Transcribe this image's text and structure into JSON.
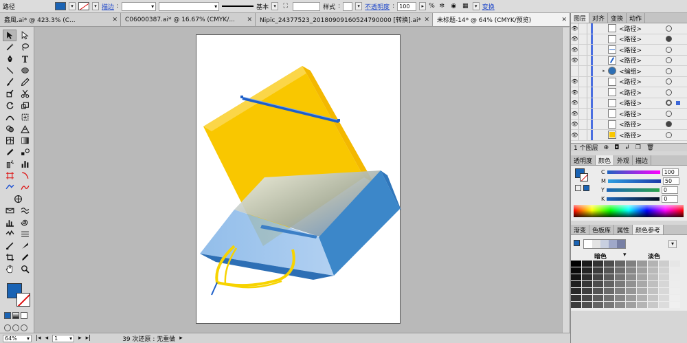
{
  "control_bar": {
    "object_type": "路径",
    "stroke_link": "描边",
    "stroke_weight": "",
    "profile": "基本",
    "style_label": "样式",
    "opacity_link": "不透明度",
    "opacity_value": "100",
    "percent": "%",
    "transform_link": "变换",
    "colors": {
      "fill": "#1a63b4"
    }
  },
  "tabs": [
    {
      "label": "鑫風.ai* @ 423.3% (C...",
      "active": false
    },
    {
      "label": "C06000387.ai* @ 16.67% (CMYK/...",
      "active": false
    },
    {
      "label": "Nipic_24377523_20180909160524790000 [转换].ai*",
      "active": false
    },
    {
      "label": "未标题-14* @ 64% (CMYK/预览)",
      "active": true
    }
  ],
  "layers_panel": {
    "tabs": [
      "图层",
      "对齐",
      "变换",
      "动作"
    ],
    "rows": [
      {
        "label": "<路径>",
        "thumb": "plain"
      },
      {
        "label": "<路径>",
        "thumb": "plain"
      },
      {
        "label": "<路径>",
        "thumb": "blue-line"
      },
      {
        "label": "<路径>",
        "thumb": "plain"
      },
      {
        "label": "<编组>",
        "thumb": "group"
      },
      {
        "label": "<路径>",
        "thumb": "plain"
      },
      {
        "label": "<路径>",
        "thumb": "plain"
      },
      {
        "label": "<路径>",
        "thumb": "plain"
      },
      {
        "label": "<路径>",
        "thumb": "plain"
      },
      {
        "label": "<路径>",
        "thumb": "plain"
      },
      {
        "label": "<路径>",
        "thumb": "yellow"
      }
    ],
    "footer_count": "1 个图层"
  },
  "color_panel": {
    "tabs": [
      "透明度",
      "颜色",
      "外观",
      "描边"
    ],
    "channels": [
      {
        "name": "C",
        "value": "100"
      },
      {
        "name": "M",
        "value": "50"
      },
      {
        "name": "Y",
        "value": "0"
      },
      {
        "name": "K",
        "value": "0"
      }
    ]
  },
  "guide_panel": {
    "tabs": [
      "渐变",
      "色板库",
      "属性",
      "颜色参考"
    ],
    "dark_label": "暗色",
    "light_label": "淡色"
  },
  "status_bar": {
    "zoom": "64%",
    "page": "1",
    "undo_text": "39 次还原 : 无重做"
  }
}
